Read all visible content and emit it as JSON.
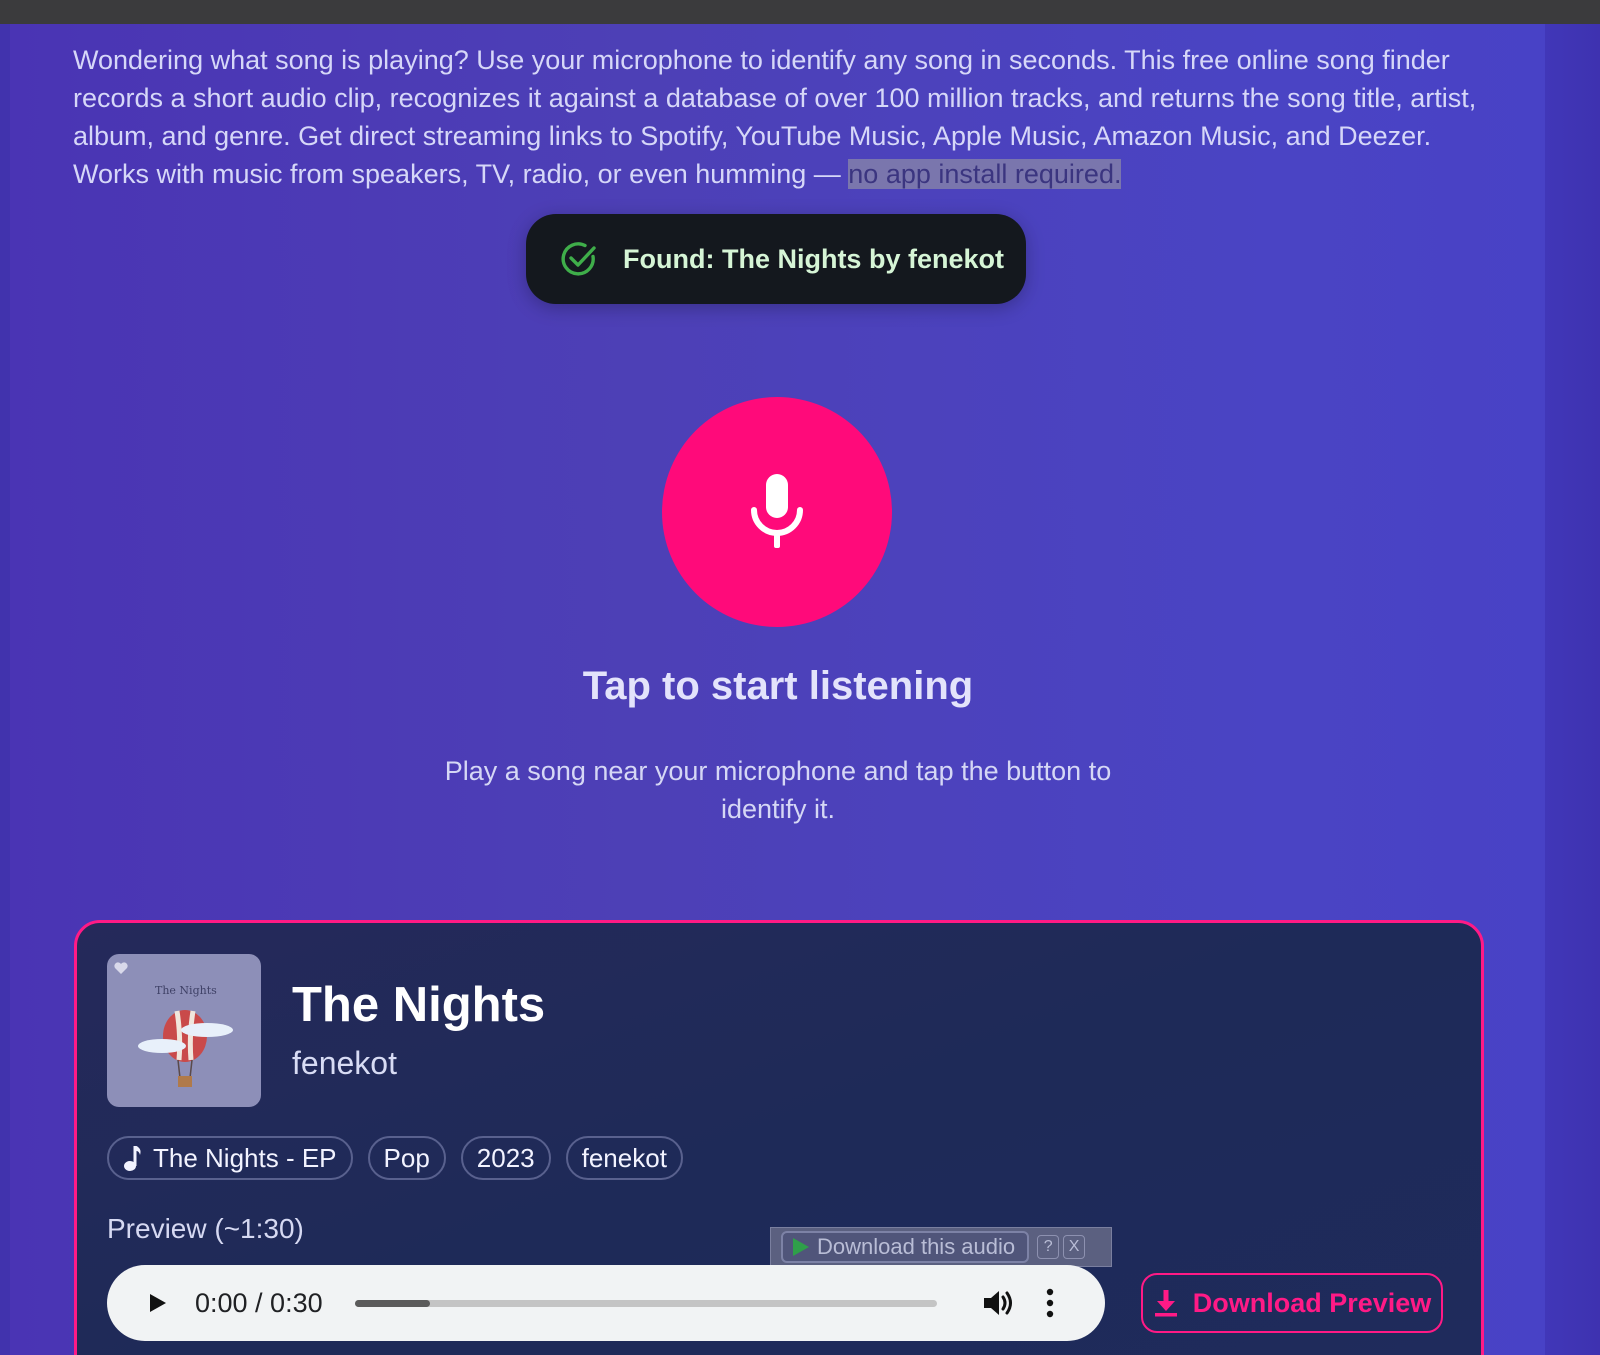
{
  "intro": {
    "text": "Wondering what song is playing? Use your microphone to identify any song in seconds. This free online song finder records a short audio clip, recognizes it against a database of over 100 million tracks, and returns the song title, artist, album, and genre. Get direct streaming links to Spotify, YouTube Music, Apple Music, Amazon Music, and Deezer. Works with music from speakers, TV, radio, or even humming — ",
    "highlight": "no app install required."
  },
  "toast": {
    "message": "Found: The Nights by fenekot",
    "icon": "check-circle-icon",
    "icon_color": "#3fae4a"
  },
  "mic": {
    "icon": "microphone-icon",
    "color": "#ff0a7a"
  },
  "listening": {
    "title": "Tap to start listening",
    "subtitle": "Play a song near your microphone and tap the button to identify it."
  },
  "result": {
    "cover_text": "The Nights",
    "title": "The Nights",
    "artist": "fenekot",
    "chips": [
      {
        "label": "The Nights - EP",
        "icon": "music-note-icon"
      },
      {
        "label": "Pop"
      },
      {
        "label": "2023"
      },
      {
        "label": "fenekot"
      }
    ],
    "preview_label": "Preview (~1:30)",
    "download_audio": {
      "label": "Download this audio",
      "help": "?",
      "close": "X"
    },
    "player": {
      "time": "0:00 / 0:30",
      "progress": 0.13
    },
    "download_preview": "Download Preview",
    "accent_color": "#ff1a86"
  }
}
